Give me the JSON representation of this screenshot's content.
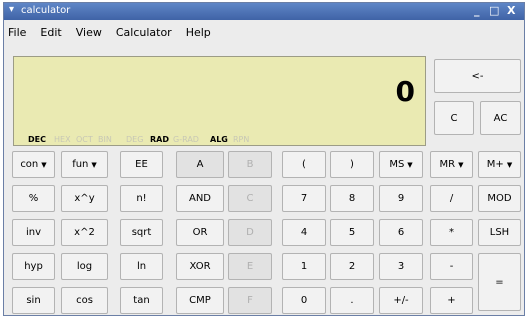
{
  "window": {
    "title": "calculator",
    "menu_arrow": "▾",
    "minimize": "_",
    "maximize": "□",
    "close": "X"
  },
  "menu": [
    "File",
    "Edit",
    "View",
    "Calculator",
    "Help"
  ],
  "display": {
    "value": "0",
    "flags": [
      {
        "label": "DEC",
        "active": true
      },
      {
        "label": "HEX",
        "active": false
      },
      {
        "label": "OCT",
        "active": false
      },
      {
        "label": "BIN",
        "active": false
      },
      {
        "label": "DEG",
        "active": false
      },
      {
        "label": "RAD",
        "active": true
      },
      {
        "label": "G-RAD",
        "active": false
      },
      {
        "label": "ALG",
        "active": true
      },
      {
        "label": "RPN",
        "active": false
      }
    ]
  },
  "side_buttons": {
    "backspace": "<-",
    "clear": "C",
    "all_clear": "AC"
  },
  "keypad": {
    "row1": [
      "con",
      "fun",
      "EE",
      "A",
      "B",
      "(",
      ")",
      "MS",
      "MR",
      "M+"
    ],
    "row2": [
      "%",
      "x^y",
      "n!",
      "AND",
      "C",
      "7",
      "8",
      "9",
      "/",
      "MOD"
    ],
    "row3": [
      "inv",
      "x^2",
      "sqrt",
      "OR",
      "D",
      "4",
      "5",
      "6",
      "*",
      "LSH"
    ],
    "row4": [
      "hyp",
      "log",
      "ln",
      "XOR",
      "E",
      "1",
      "2",
      "3",
      "-",
      "="
    ],
    "row5": [
      "sin",
      "cos",
      "tan",
      "CMP",
      "F",
      "0",
      ".",
      "+/-",
      "+"
    ]
  }
}
